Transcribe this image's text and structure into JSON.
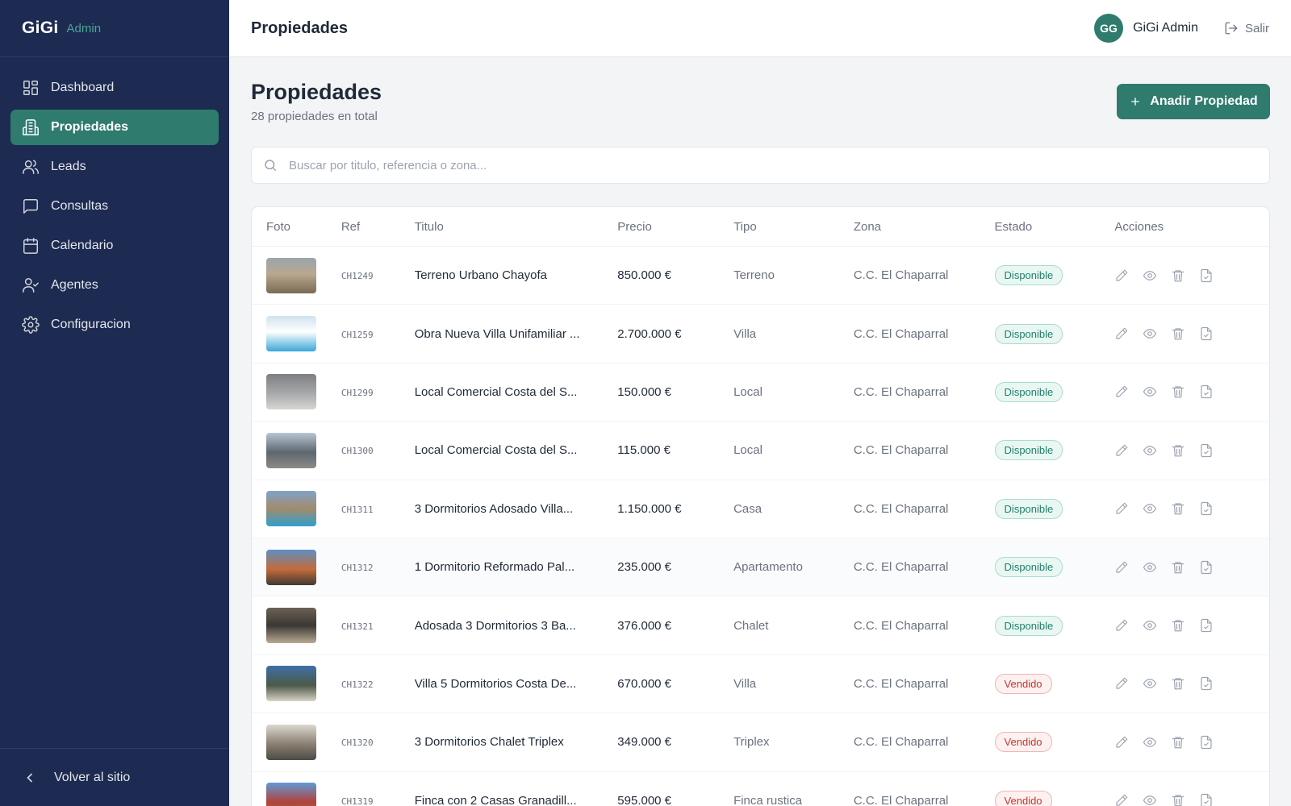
{
  "brand": {
    "name": "GiGi",
    "tag": "Admin"
  },
  "sidebar": {
    "items": [
      {
        "label": "Dashboard",
        "icon": "grid-icon"
      },
      {
        "label": "Propiedades",
        "icon": "building-icon",
        "active": true
      },
      {
        "label": "Leads",
        "icon": "users-icon"
      },
      {
        "label": "Consultas",
        "icon": "message-icon"
      },
      {
        "label": "Calendario",
        "icon": "calendar-icon"
      },
      {
        "label": "Agentes",
        "icon": "user-check-icon"
      },
      {
        "label": "Configuracion",
        "icon": "gear-icon"
      }
    ],
    "footer_label": "Volver al sitio"
  },
  "topbar": {
    "title": "Propiedades",
    "avatar_initials": "GG",
    "user_name": "GiGi Admin",
    "logout_label": "Salir"
  },
  "page": {
    "title": "Propiedades",
    "subtitle": "28 propiedades en total",
    "add_button": "Anadir Propiedad",
    "search_placeholder": "Buscar por titulo, referencia o zona..."
  },
  "colors": {
    "accent": "#2f7b6e",
    "sidebar": "#1d2b52",
    "available": "#21806d",
    "sold": "#c0392b"
  },
  "table": {
    "columns": [
      "Foto",
      "Ref",
      "Titulo",
      "Precio",
      "Tipo",
      "Zona",
      "Estado",
      "Acciones"
    ],
    "rows": [
      {
        "ref": "CH1249",
        "title": "Terreno Urbano Chayofa",
        "price": "850.000 €",
        "type": "Terreno",
        "zone": "C.C. El Chaparral",
        "status": "Disponible",
        "sold": false
      },
      {
        "ref": "CH1259",
        "title": "Obra Nueva Villa Unifamiliar ...",
        "price": "2.700.000 €",
        "type": "Villa",
        "zone": "C.C. El Chaparral",
        "status": "Disponible",
        "sold": false
      },
      {
        "ref": "CH1299",
        "title": "Local Comercial Costa del S...",
        "price": "150.000 €",
        "type": "Local",
        "zone": "C.C. El Chaparral",
        "status": "Disponible",
        "sold": false
      },
      {
        "ref": "CH1300",
        "title": "Local Comercial Costa del S...",
        "price": "115.000 €",
        "type": "Local",
        "zone": "C.C. El Chaparral",
        "status": "Disponible",
        "sold": false
      },
      {
        "ref": "CH1311",
        "title": "3 Dormitorios Adosado Villa...",
        "price": "1.150.000 €",
        "type": "Casa",
        "zone": "C.C. El Chaparral",
        "status": "Disponible",
        "sold": false
      },
      {
        "ref": "CH1312",
        "title": "1 Dormitorio Reformado Pal...",
        "price": "235.000 €",
        "type": "Apartamento",
        "zone": "C.C. El Chaparral",
        "status": "Disponible",
        "sold": false
      },
      {
        "ref": "CH1321",
        "title": "Adosada 3 Dormitorios 3 Ba...",
        "price": "376.000 €",
        "type": "Chalet",
        "zone": "C.C. El Chaparral",
        "status": "Disponible",
        "sold": false
      },
      {
        "ref": "CH1322",
        "title": "Villa 5 Dormitorios Costa De...",
        "price": "670.000 €",
        "type": "Villa",
        "zone": "C.C. El Chaparral",
        "status": "Vendido",
        "sold": true
      },
      {
        "ref": "CH1320",
        "title": "3 Dormitorios Chalet Triplex",
        "price": "349.000 €",
        "type": "Triplex",
        "zone": "C.C. El Chaparral",
        "status": "Vendido",
        "sold": true
      },
      {
        "ref": "CH1319",
        "title": "Finca con 2 Casas Granadill...",
        "price": "595.000 €",
        "type": "Finca rustica",
        "zone": "C.C. El Chaparral",
        "status": "Vendido",
        "sold": true
      }
    ]
  }
}
